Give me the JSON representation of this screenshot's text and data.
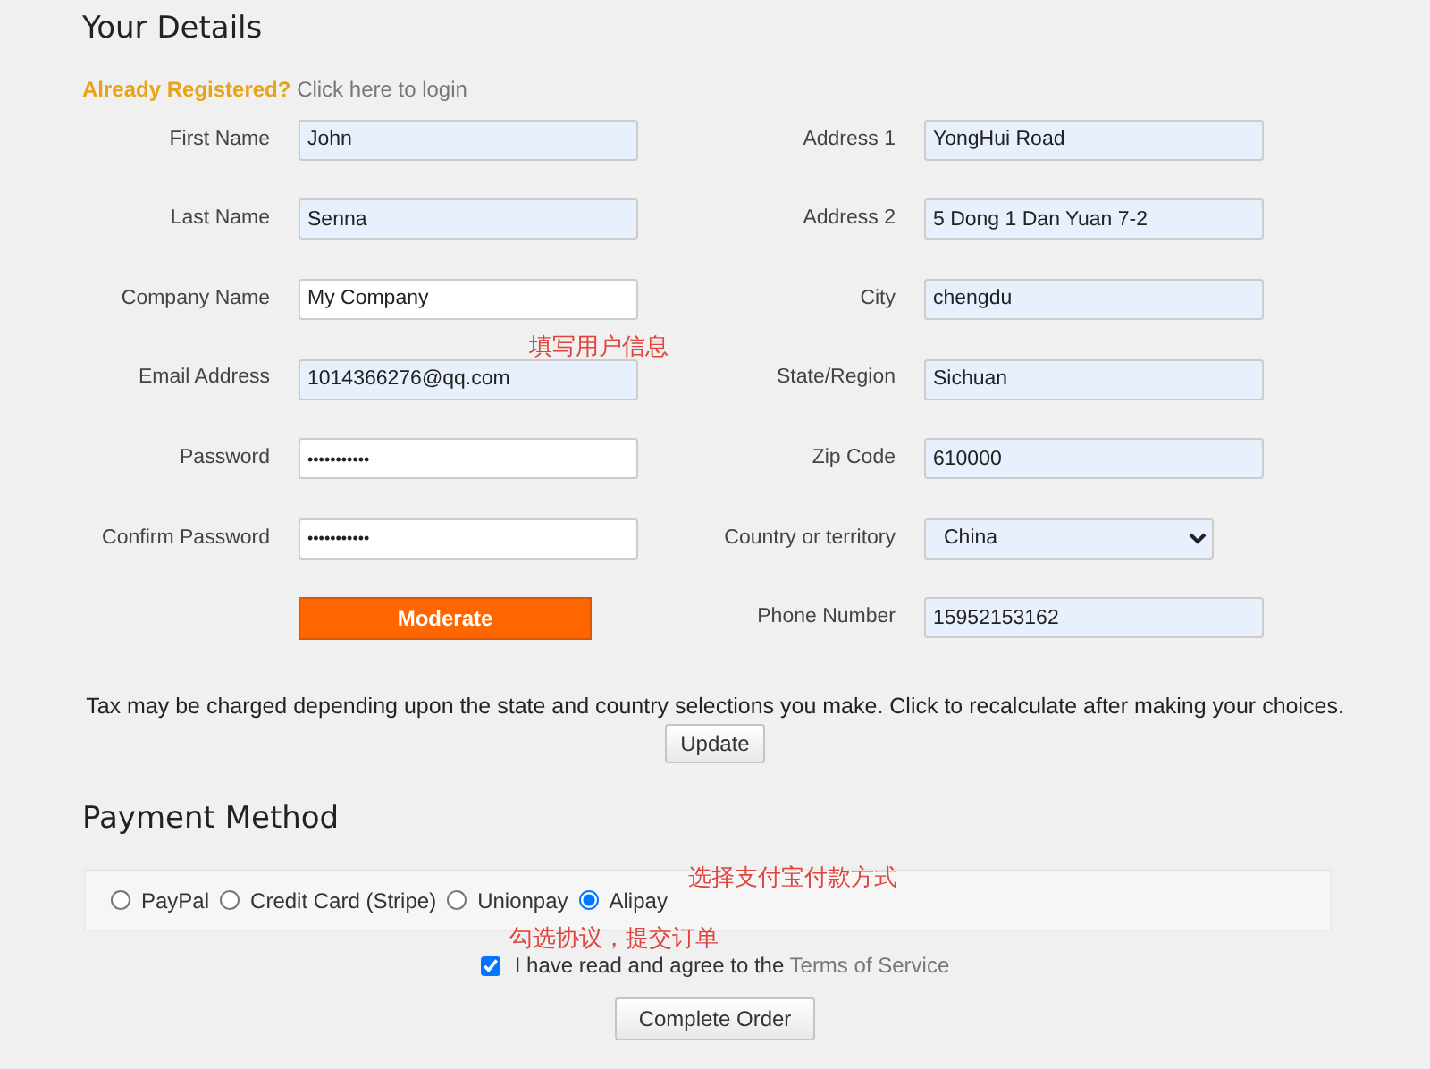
{
  "heading": "Your Details",
  "login_prompt": {
    "lead": "Already Registered?",
    "link": "Click here to login"
  },
  "left_fields": [
    {
      "label": "First Name",
      "kind": "text",
      "value": "John",
      "autofilled": true
    },
    {
      "label": "Last Name",
      "kind": "text",
      "value": "Senna",
      "autofilled": true
    },
    {
      "label": "Company Name",
      "kind": "text",
      "value": "My Company",
      "autofilled": false
    },
    {
      "label": "Email Address",
      "kind": "text",
      "value": "1014366276@qq.com",
      "autofilled": true
    },
    {
      "label": "Password",
      "kind": "password",
      "value": "•••••••••••",
      "autofilled": false
    },
    {
      "label": "Confirm Password",
      "kind": "password",
      "value": "•••••••••••",
      "autofilled": false
    }
  ],
  "strength_button": "Moderate",
  "right_fields": [
    {
      "label": "Address 1",
      "kind": "text",
      "value": "YongHui Road",
      "autofilled": true
    },
    {
      "label": "Address 2",
      "kind": "text",
      "value": "5 Dong 1 Dan Yuan 7-2",
      "autofilled": true
    },
    {
      "label": "City",
      "kind": "text",
      "value": "chengdu",
      "autofilled": true
    },
    {
      "label": "State/Region",
      "kind": "text",
      "value": "Sichuan",
      "autofilled": true
    },
    {
      "label": "Zip Code",
      "kind": "text",
      "value": "610000",
      "autofilled": true
    },
    {
      "label": "Country or territory",
      "kind": "select",
      "value": "China",
      "autofilled": true
    },
    {
      "label": "Phone Number",
      "kind": "text",
      "value": "15952153162",
      "autofilled": true
    }
  ],
  "tax_note": "Tax may be charged depending upon the state and country selections you make. Click to recalculate after making your choices.",
  "update_button": "Update",
  "payment": {
    "heading": "Payment Method",
    "options": [
      {
        "label": "PayPal",
        "selected": false
      },
      {
        "label": "Credit Card (Stripe)",
        "selected": false
      },
      {
        "label": "Unionpay",
        "selected": false
      },
      {
        "label": "Alipay",
        "selected": true
      }
    ]
  },
  "terms": {
    "checked": true,
    "text": "I have read and agree to the",
    "link": "Terms of Service"
  },
  "complete_button": "Complete Order",
  "annotations": [
    {
      "text": "填写用户信息"
    },
    {
      "text": "选择支付宝付款方式"
    },
    {
      "text": "勾选协议，提交订单"
    }
  ]
}
